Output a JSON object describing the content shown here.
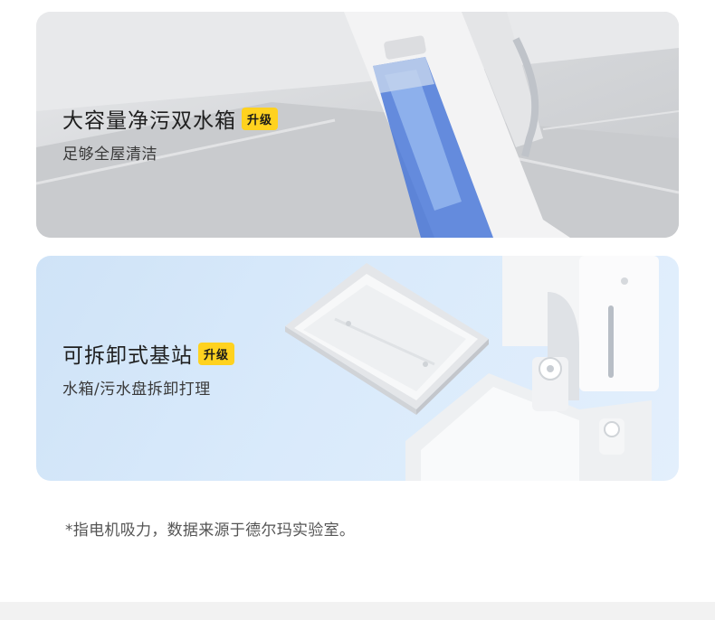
{
  "card1": {
    "title": "大容量净污双水箱",
    "badge": "升级",
    "subtitle": "足够全屋清洁"
  },
  "card2": {
    "title": "可拆卸式基站",
    "badge": "升级",
    "subtitle": "水箱/污水盘拆卸打理"
  },
  "footnote": "*指电机吸力，数据来源于德尔玛实验室。",
  "colors": {
    "badge": "#ffd21f",
    "card2_bg": "#d9eafb",
    "water_blue": "#4a78d8"
  }
}
